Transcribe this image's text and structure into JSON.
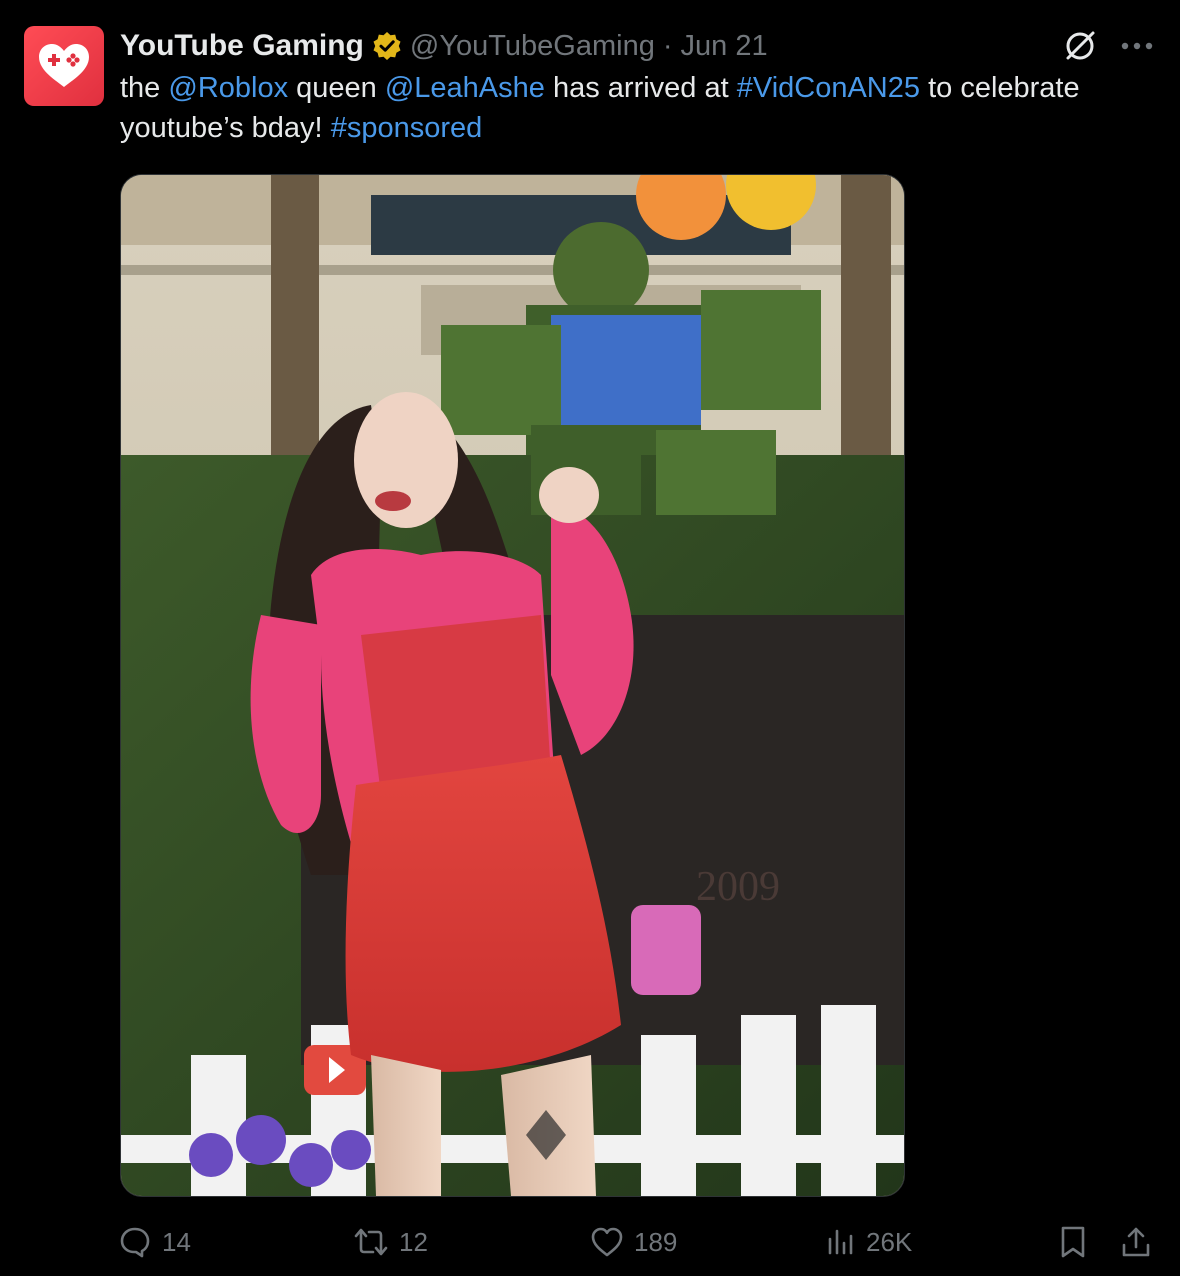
{
  "author": {
    "display_name": "YouTube Gaming",
    "handle": "@YouTubeGaming",
    "separator": "·",
    "date": "Jun 21",
    "avatar_icon": "youtube-gaming-controller-heart-icon",
    "brand_color": "#e8323f",
    "verified_icon": "gold-verified-badge-icon"
  },
  "tweet": {
    "segments": [
      {
        "text": "the ",
        "link": false
      },
      {
        "text": "@Roblox",
        "link": true
      },
      {
        "text": " queen ",
        "link": false
      },
      {
        "text": "@LeahAshe",
        "link": true
      },
      {
        "text": " has arrived at ",
        "link": false
      },
      {
        "text": "#VidConAN25",
        "link": true
      },
      {
        "text": " to celebrate youtube’s bday! ",
        "link": false
      },
      {
        "text": "#sponsored",
        "link": true
      }
    ],
    "link_color": "#4a99e9"
  },
  "media": {
    "icon": "photo-woman-in-pink-outfit-at-roblox-topiary-icon",
    "sign_text": "2009"
  },
  "actions": {
    "replies": "14",
    "reposts": "12",
    "likes": "189",
    "views": "26K"
  },
  "colors": {
    "background": "#000000",
    "text": "#e7e9ea",
    "muted": "#71767b"
  }
}
